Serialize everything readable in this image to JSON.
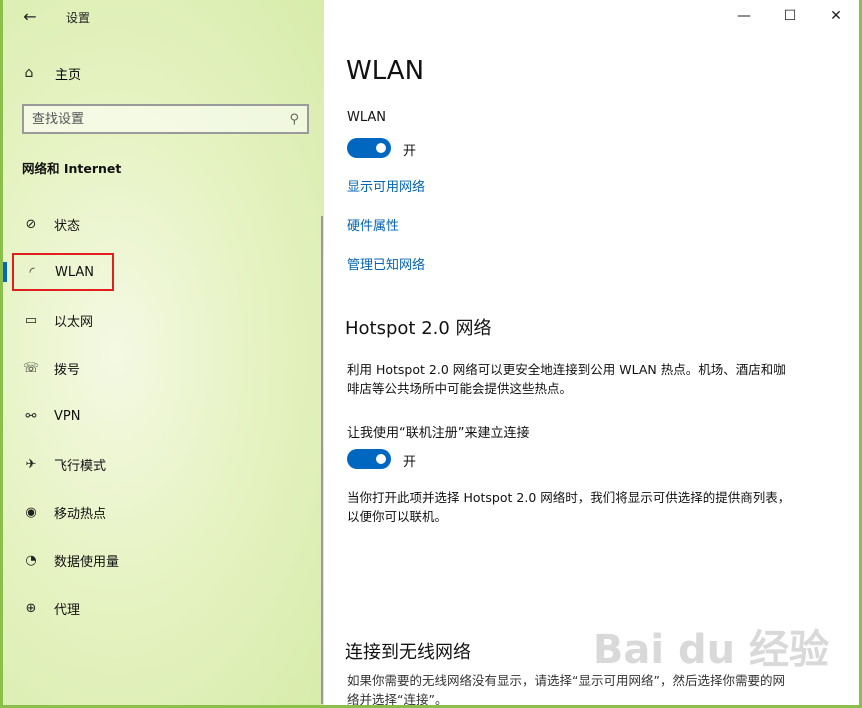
{
  "window": {
    "title": "设置"
  },
  "sidebar": {
    "back_icon": "←",
    "home": {
      "icon": "⌂",
      "label": "主页"
    },
    "search": {
      "placeholder": "查找设置",
      "icon": "⚲"
    },
    "section_title": "网络和 Internet",
    "items": [
      {
        "icon": "⊘",
        "label": "状态",
        "active": false
      },
      {
        "icon": "◜",
        "label": "WLAN",
        "active": true
      },
      {
        "icon": "▭",
        "label": "以太网",
        "active": false
      },
      {
        "icon": "☏",
        "label": "拨号",
        "active": false
      },
      {
        "icon": "⚯",
        "label": "VPN",
        "active": false
      },
      {
        "icon": "✈",
        "label": "飞行模式",
        "active": false
      },
      {
        "icon": "◉",
        "label": "移动热点",
        "active": false
      },
      {
        "icon": "◔",
        "label": "数据使用量",
        "active": false
      },
      {
        "icon": "⊕",
        "label": "代理",
        "active": false
      }
    ]
  },
  "window_controls": {
    "minimize": "—",
    "maximize": "☐",
    "close": "✕"
  },
  "main": {
    "title": "WLAN",
    "wlan_label": "WLAN",
    "wlan_toggle_state": "开",
    "links": [
      "显示可用网络",
      "硬件属性",
      "管理已知网络"
    ],
    "hotspot_title": "Hotspot 2.0 网络",
    "hotspot_desc": "利用 Hotspot 2.0 网络可以更安全地连接到公用 WLAN 热点。机场、酒店和咖啡店等公共场所中可能会提供这些热点。",
    "online_reg_label": "让我使用“联机注册”来建立连接",
    "online_reg_state": "开",
    "hotspot_note": "当你打开此项并选择 Hotspot 2.0 网络时，我们将显示可供选择的提供商列表，以便你可以联机。",
    "connect_title": "连接到无线网络",
    "connect_desc": "如果你需要的无线网络没有显示，请选择“显示可用网络”，然后选择你需要的网络并选择“连接”。"
  },
  "watermark": "Bai du 经验"
}
